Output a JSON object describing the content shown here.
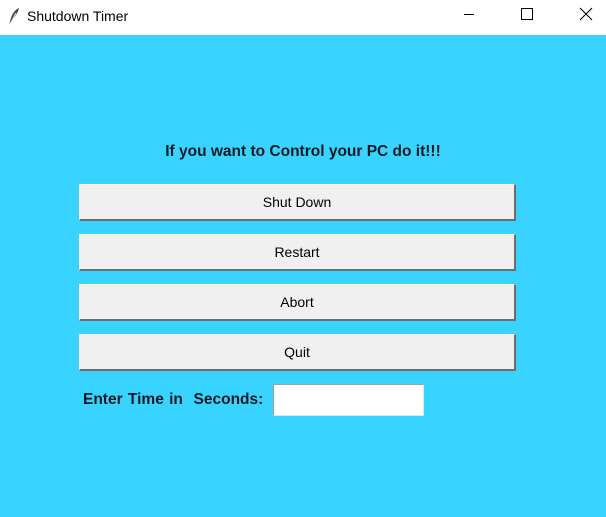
{
  "window": {
    "title": "Shutdown Timer",
    "app_icon": "feather-icon",
    "controls": {
      "minimize": "minimize-icon",
      "maximize": "maximize-icon",
      "close": "close-icon"
    }
  },
  "main": {
    "heading": "If you want to Control your PC do it!!!",
    "buttons": {
      "shutdown": "Shut Down",
      "restart": "Restart",
      "abort": "Abort",
      "quit": "Quit"
    },
    "time_label": "Enter Time in  Seconds:",
    "time_input": {
      "value": "",
      "placeholder": ""
    }
  },
  "colors": {
    "background": "#38d3ff",
    "button_face": "#f0f0f0",
    "titlebar": "#ffffff"
  }
}
